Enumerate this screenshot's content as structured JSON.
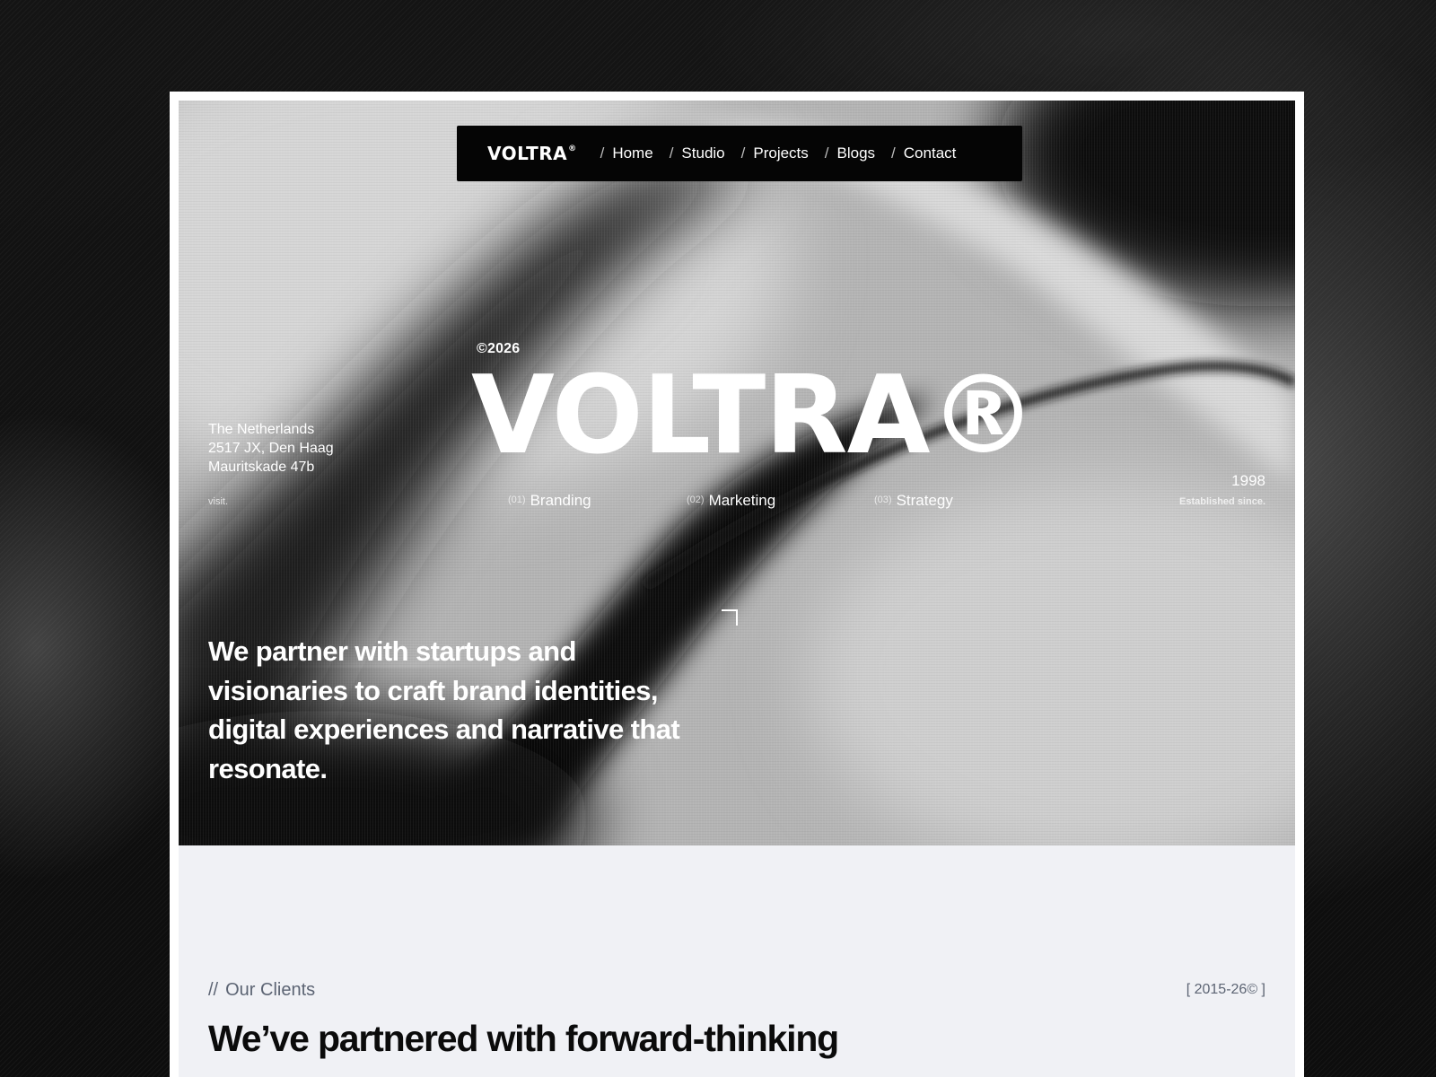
{
  "nav": {
    "logo": "VOLTRA",
    "logo_mark": "®",
    "separator": "/",
    "items": [
      {
        "label": "Home"
      },
      {
        "label": "Studio"
      },
      {
        "label": "Projects"
      },
      {
        "label": "Blogs"
      },
      {
        "label": "Contact"
      }
    ]
  },
  "hero": {
    "copyright": "©2026",
    "title": "VOLTRA®",
    "address": {
      "line1": "The Netherlands",
      "line2": "2517 JX, Den Haag",
      "line3": "Mauritskade 47b"
    },
    "visit_label": "visit.",
    "services": [
      {
        "num": "(01)",
        "label": "Branding"
      },
      {
        "num": "(02)",
        "label": "Marketing"
      },
      {
        "num": "(03)",
        "label": "Strategy"
      }
    ],
    "year": "1998",
    "established_label": "Established since.",
    "tagline": "We partner with startups and visionaries  to craft brand identities, digital experiences  and narrative that resonate."
  },
  "clients": {
    "slashes": "//",
    "label": "Our Clients",
    "range": "[ 2015-26© ]",
    "heading": "We’ve partnered with forward-thinking"
  }
}
